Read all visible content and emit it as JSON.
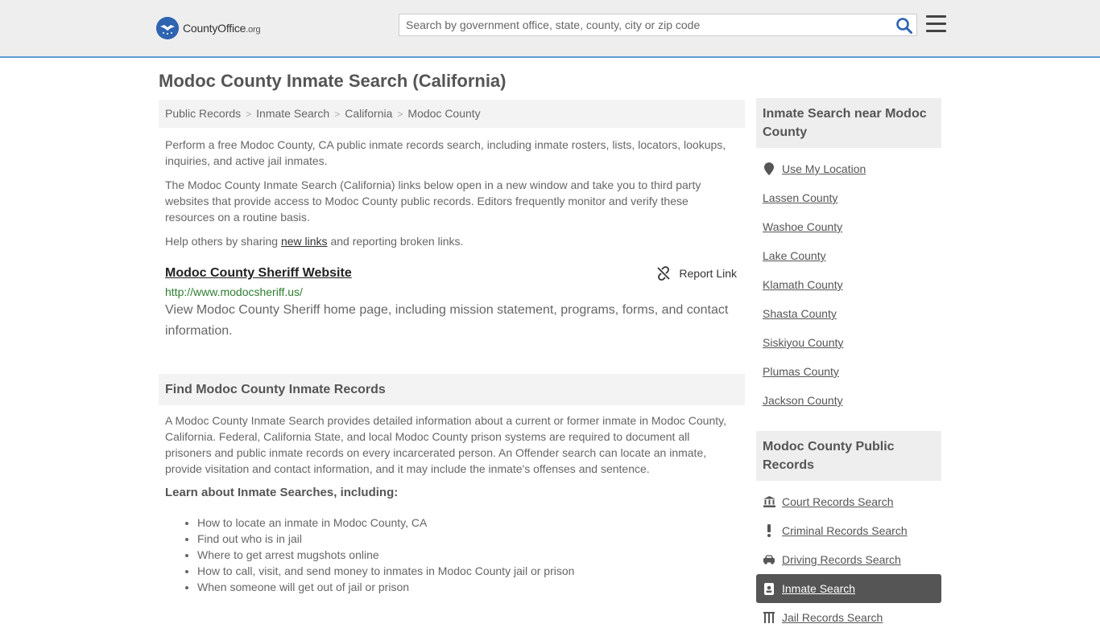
{
  "header": {
    "logo_name": "CountyOffice",
    "logo_suffix": ".org",
    "search_placeholder": "Search by government office, state, county, city or zip code"
  },
  "page": {
    "title": "Modoc County Inmate Search (California)"
  },
  "breadcrumb": [
    "Public Records",
    "Inmate Search",
    "California",
    "Modoc County"
  ],
  "intro": {
    "p1": "Perform a free Modoc County, CA public inmate records search, including inmate rosters, lists, locators, lookups, inquiries, and active jail inmates.",
    "p2": "The Modoc County Inmate Search (California) links below open in a new window and take you to third party websites that provide access to Modoc County public records. Editors frequently monitor and verify these resources on a routine basis.",
    "p3_before": "Help others by sharing ",
    "p3_link": "new links",
    "p3_after": " and reporting broken links."
  },
  "link_item": {
    "title": "Modoc County Sheriff Website",
    "report_label": "Report Link",
    "url": "http://www.modocsheriff.us/",
    "description": "View Modoc County Sheriff home page, including mission statement, programs, forms, and contact information."
  },
  "find_section": {
    "heading": "Find Modoc County Inmate Records",
    "body": "A Modoc County Inmate Search provides detailed information about a current or former inmate in Modoc County, California. Federal, California State, and local Modoc County prison systems are required to document all prisoners and public inmate records on every incarcerated person. An Offender search can locate an inmate, provide visitation and contact information, and it may include the inmate's offenses and sentence.",
    "subheading": "Learn about Inmate Searches, including:",
    "bullets": [
      "How to locate an inmate in Modoc County, CA",
      "Find out who is in jail",
      "Where to get arrest mugshots online",
      "How to call, visit, and send money to inmates in Modoc County jail or prison",
      "When someone will get out of jail or prison"
    ]
  },
  "sidebar": {
    "near_heading": "Inmate Search near Modoc County",
    "use_location": "Use My Location",
    "near_items": [
      "Lassen County",
      "Washoe County",
      "Lake County",
      "Klamath County",
      "Shasta County",
      "Siskiyou County",
      "Plumas County",
      "Jackson County"
    ],
    "records_heading": "Modoc County Public Records",
    "records_items": [
      {
        "label": "Court Records Search",
        "icon": "courthouse-icon"
      },
      {
        "label": "Criminal Records Search",
        "icon": "exclamation-icon"
      },
      {
        "label": "Driving Records Search",
        "icon": "car-icon"
      },
      {
        "label": "Inmate Search",
        "icon": "id-badge-icon",
        "active": true
      },
      {
        "label": "Jail Records Search",
        "icon": "jail-icon"
      }
    ]
  },
  "colors": {
    "header_bg": "#eeeeee",
    "header_border": "#5b9bd5",
    "logo_blue": "#2e64b0",
    "url_green": "#2f7d32",
    "active_bg": "#555555"
  }
}
